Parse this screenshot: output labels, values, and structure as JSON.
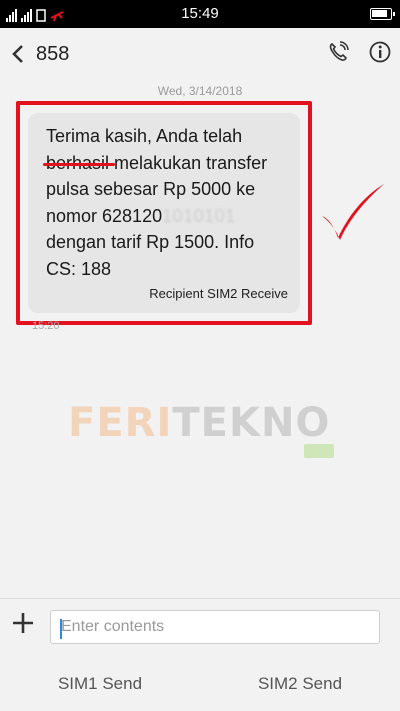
{
  "status_bar": {
    "time": "15:49"
  },
  "header": {
    "back_icon": "chevron-left-icon",
    "contact": "858",
    "call_icon": "phone-call-icon",
    "info_icon": "info-icon"
  },
  "conversation": {
    "date": "Wed, 3/14/2018",
    "message": {
      "text_line1": "Terima kasih, Anda telah",
      "text_word_berhasil": "berhasil",
      "text_after_berhasil": " melakukan transfer",
      "text_line3": "pulsa sebesar Rp 5000 ke",
      "text_number_prefix": "nomor 628120",
      "text_number_hidden": "1010101",
      "text_line5": "dengan tarif Rp 1500. Info",
      "text_line6": "CS: 188",
      "recipient": "Recipient SIM2 Receive",
      "time": "15:20"
    }
  },
  "watermark": {
    "part1": "FERI",
    "part2": "TEKNO",
    "badge": ".com"
  },
  "compose": {
    "placeholder": "Enter contents",
    "value": ""
  },
  "send": {
    "sim1_label": "SIM1 Send",
    "sim2_label": "SIM2 Send"
  },
  "colors": {
    "highlight_red": "#e2131e",
    "bubble_bg": "#e6e6e6"
  }
}
